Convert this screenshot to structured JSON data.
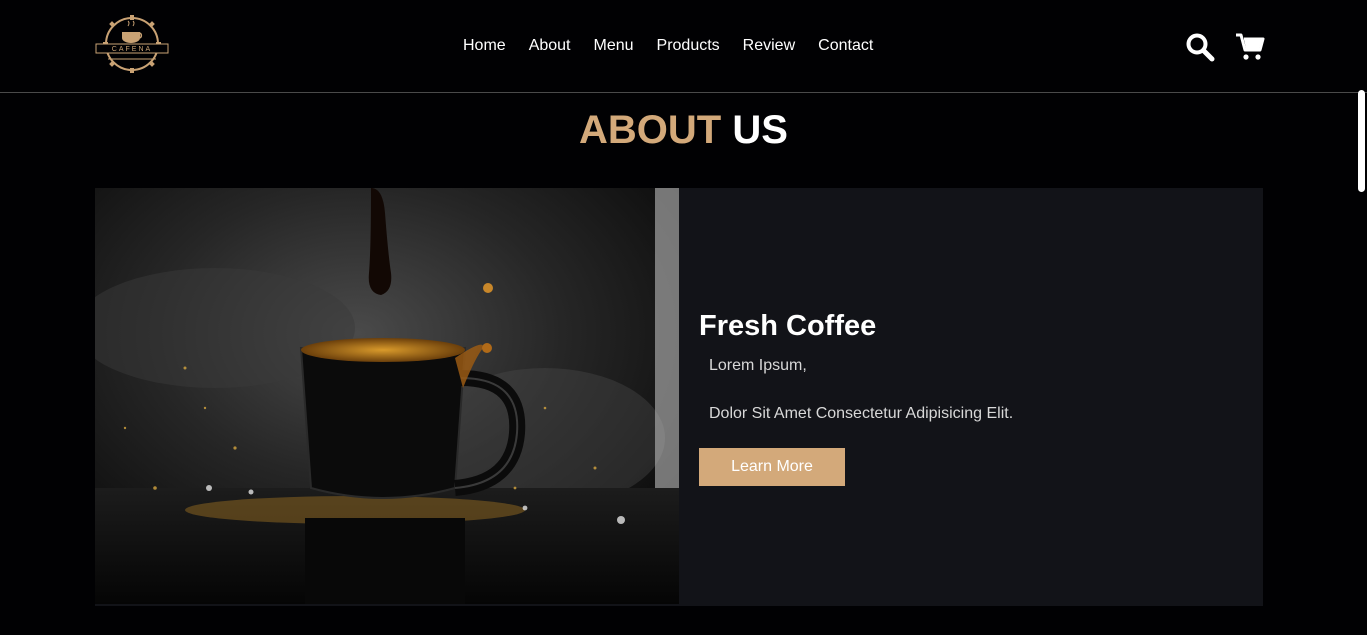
{
  "header": {
    "logo_text": "CAFENA",
    "nav": [
      "Home",
      "About",
      "Menu",
      "Products",
      "Review",
      "Contact"
    ],
    "icons": [
      "search-icon",
      "cart-icon"
    ]
  },
  "about": {
    "title_accent": "ABOUT",
    "title_plain": "US",
    "heading": "Fresh Coffee",
    "line1": "Lorem Ipsum,",
    "line2": "Dolor Sit Amet Consectetur Adipisicing Elit.",
    "button_label": "Learn More",
    "image_alt": "coffee-splash-image"
  },
  "colors": {
    "accent": "#d3a97a",
    "background": "#010103",
    "card": "#121318"
  }
}
